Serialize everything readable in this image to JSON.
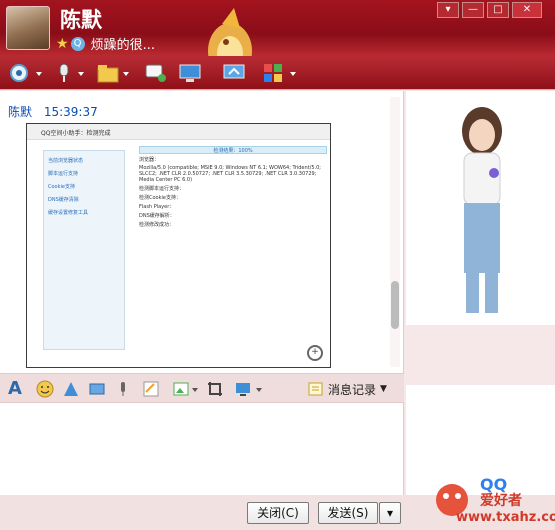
{
  "title_bar": {
    "contact_name": "陈默",
    "signature": "烦躁的很...",
    "buttons": [
      "▾",
      "—",
      "□",
      "✕"
    ]
  },
  "toolbar": {
    "icons": [
      "video-call-icon",
      "voice-call-icon",
      "send-file-icon",
      "sms-icon",
      "share-screen-icon",
      "remote-assist-icon",
      "apps-icon"
    ]
  },
  "message": {
    "sender": "陈默",
    "time": "15:39:37",
    "screenshot": {
      "window_title": "QQ空间小助手：检测完成",
      "side_items": [
        "当前浏览器状态",
        "脚本运行支持",
        "Cookie支持",
        "DNS缓存清除",
        "缓存设置修复工具"
      ],
      "main_header": "检测结果：100%",
      "main_lines": [
        "浏览器：",
        "Mozilla/5.0 (compatible; MSIE 9.0; Windows NT 6.1; WOW64; Trident/5.0; SLCC2; .NET CLR 2.0.50727; .NET CLR 3.5.30729; .NET CLR 3.0.30729; Media Center PC 6.0)",
        "检测脚本运行支持：",
        "检测Cookie支持：",
        "Flash Player：",
        "DNS缓存解析：",
        "检测修改成功："
      ]
    }
  },
  "bottom_toolbar": {
    "history_label": "消息记录"
  },
  "footer": {
    "close_label": "关闭(C)",
    "send_label": "发送(S)"
  },
  "watermark": {
    "brand": "爱好者",
    "url": "www.txahz.com"
  },
  "colors": {
    "title_red": "#a3141e",
    "accent_blue": "#0b4eb2"
  }
}
